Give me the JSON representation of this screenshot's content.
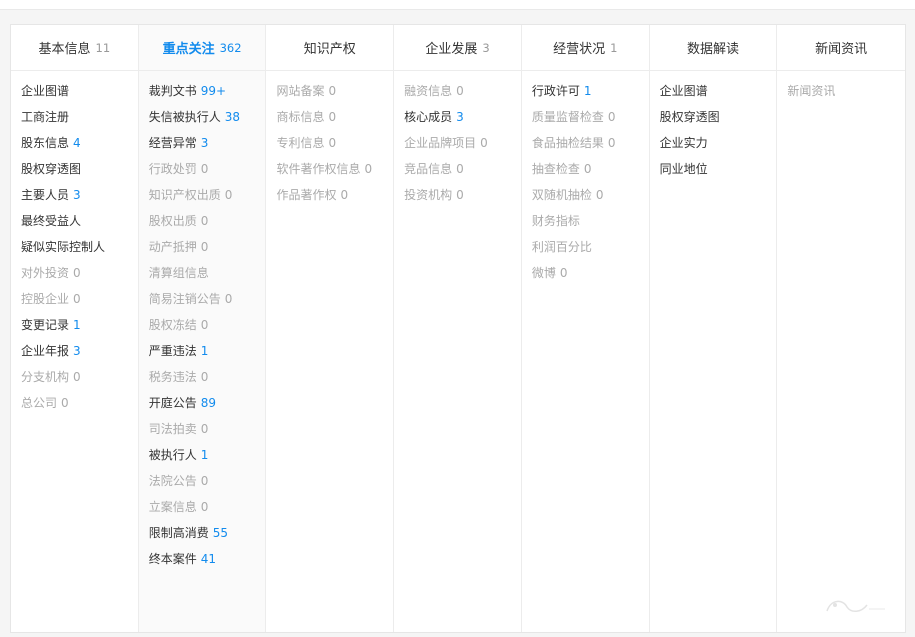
{
  "tabs": [
    {
      "title": "基本信息",
      "count": "11",
      "active": false,
      "items": [
        {
          "label": "企业图谱",
          "num": "",
          "dim": false,
          "numStyle": ""
        },
        {
          "label": "工商注册",
          "num": "",
          "dim": false,
          "numStyle": ""
        },
        {
          "label": "股东信息",
          "num": "4",
          "dim": false,
          "numStyle": "blue"
        },
        {
          "label": "股权穿透图",
          "num": "",
          "dim": false,
          "numStyle": ""
        },
        {
          "label": "主要人员",
          "num": "3",
          "dim": false,
          "numStyle": "blue"
        },
        {
          "label": "最终受益人",
          "num": "",
          "dim": false,
          "numStyle": ""
        },
        {
          "label": "疑似实际控制人",
          "num": "",
          "dim": false,
          "numStyle": ""
        },
        {
          "label": "对外投资",
          "num": "0",
          "dim": true,
          "numStyle": "gray"
        },
        {
          "label": "控股企业",
          "num": "0",
          "dim": true,
          "numStyle": "gray"
        },
        {
          "label": "变更记录",
          "num": "1",
          "dim": false,
          "numStyle": "blue"
        },
        {
          "label": "企业年报",
          "num": "3",
          "dim": false,
          "numStyle": "blue"
        },
        {
          "label": "分支机构",
          "num": "0",
          "dim": true,
          "numStyle": "gray"
        },
        {
          "label": "总公司",
          "num": "0",
          "dim": true,
          "numStyle": "gray"
        }
      ]
    },
    {
      "title": "重点关注",
      "count": "362",
      "active": true,
      "items": [
        {
          "label": "裁判文书",
          "num": "99+",
          "dim": false,
          "numStyle": "blue"
        },
        {
          "label": "失信被执行人",
          "num": "38",
          "dim": false,
          "numStyle": "blue"
        },
        {
          "label": "经营异常",
          "num": "3",
          "dim": false,
          "numStyle": "blue"
        },
        {
          "label": "行政处罚",
          "num": "0",
          "dim": true,
          "numStyle": "gray"
        },
        {
          "label": "知识产权出质",
          "num": "0",
          "dim": true,
          "numStyle": "gray"
        },
        {
          "label": "股权出质",
          "num": "0",
          "dim": true,
          "numStyle": "gray"
        },
        {
          "label": "动产抵押",
          "num": "0",
          "dim": true,
          "numStyle": "gray"
        },
        {
          "label": "清算组信息",
          "num": "",
          "dim": true,
          "numStyle": ""
        },
        {
          "label": "简易注销公告",
          "num": "0",
          "dim": true,
          "numStyle": "gray"
        },
        {
          "label": "股权冻结",
          "num": "0",
          "dim": true,
          "numStyle": "gray"
        },
        {
          "label": "严重违法",
          "num": "1",
          "dim": false,
          "numStyle": "blue"
        },
        {
          "label": "税务违法",
          "num": "0",
          "dim": true,
          "numStyle": "gray"
        },
        {
          "label": "开庭公告",
          "num": "89",
          "dim": false,
          "numStyle": "blue"
        },
        {
          "label": "司法拍卖",
          "num": "0",
          "dim": true,
          "numStyle": "gray"
        },
        {
          "label": "被执行人",
          "num": "1",
          "dim": false,
          "numStyle": "blue"
        },
        {
          "label": "法院公告",
          "num": "0",
          "dim": true,
          "numStyle": "gray"
        },
        {
          "label": "立案信息",
          "num": "0",
          "dim": true,
          "numStyle": "gray"
        },
        {
          "label": "限制高消费",
          "num": "55",
          "dim": false,
          "numStyle": "blue"
        },
        {
          "label": "终本案件",
          "num": "41",
          "dim": false,
          "numStyle": "blue"
        }
      ]
    },
    {
      "title": "知识产权",
      "count": "",
      "active": false,
      "items": [
        {
          "label": "网站备案",
          "num": "0",
          "dim": true,
          "numStyle": "gray"
        },
        {
          "label": "商标信息",
          "num": "0",
          "dim": true,
          "numStyle": "gray"
        },
        {
          "label": "专利信息",
          "num": "0",
          "dim": true,
          "numStyle": "gray"
        },
        {
          "label": "软件著作权信息",
          "num": "0",
          "dim": true,
          "numStyle": "gray"
        },
        {
          "label": "作品著作权",
          "num": "0",
          "dim": true,
          "numStyle": "gray"
        }
      ]
    },
    {
      "title": "企业发展",
      "count": "3",
      "active": false,
      "items": [
        {
          "label": "融资信息",
          "num": "0",
          "dim": true,
          "numStyle": "gray"
        },
        {
          "label": "核心成员",
          "num": "3",
          "dim": false,
          "numStyle": "blue"
        },
        {
          "label": "企业品牌项目",
          "num": "0",
          "dim": true,
          "numStyle": "gray"
        },
        {
          "label": "竞品信息",
          "num": "0",
          "dim": true,
          "numStyle": "gray"
        },
        {
          "label": "投资机构",
          "num": "0",
          "dim": true,
          "numStyle": "gray"
        }
      ]
    },
    {
      "title": "经营状况",
      "count": "1",
      "active": false,
      "items": [
        {
          "label": "行政许可",
          "num": "1",
          "dim": false,
          "numStyle": "blue"
        },
        {
          "label": "质量监督检查",
          "num": "0",
          "dim": true,
          "numStyle": "gray"
        },
        {
          "label": "食品抽检结果",
          "num": "0",
          "dim": true,
          "numStyle": "gray"
        },
        {
          "label": "抽查检查",
          "num": "0",
          "dim": true,
          "numStyle": "gray"
        },
        {
          "label": "双随机抽检",
          "num": "0",
          "dim": true,
          "numStyle": "gray"
        },
        {
          "label": "财务指标",
          "num": "",
          "dim": true,
          "numStyle": ""
        },
        {
          "label": "利润百分比",
          "num": "",
          "dim": true,
          "numStyle": ""
        },
        {
          "label": "微博",
          "num": "0",
          "dim": true,
          "numStyle": "gray"
        }
      ]
    },
    {
      "title": "数据解读",
      "count": "",
      "active": false,
      "items": [
        {
          "label": "企业图谱",
          "num": "",
          "dim": false,
          "numStyle": ""
        },
        {
          "label": "股权穿透图",
          "num": "",
          "dim": false,
          "numStyle": ""
        },
        {
          "label": "企业实力",
          "num": "",
          "dim": false,
          "numStyle": ""
        },
        {
          "label": "同业地位",
          "num": "",
          "dim": false,
          "numStyle": ""
        }
      ]
    },
    {
      "title": "新闻资讯",
      "count": "",
      "active": false,
      "items": [
        {
          "label": "新闻资讯",
          "num": "",
          "dim": true,
          "numStyle": ""
        }
      ]
    }
  ],
  "colors": {
    "accent": "#128bed",
    "text": "#333333",
    "dim": "#aaaaaa",
    "border": "#ececec"
  }
}
